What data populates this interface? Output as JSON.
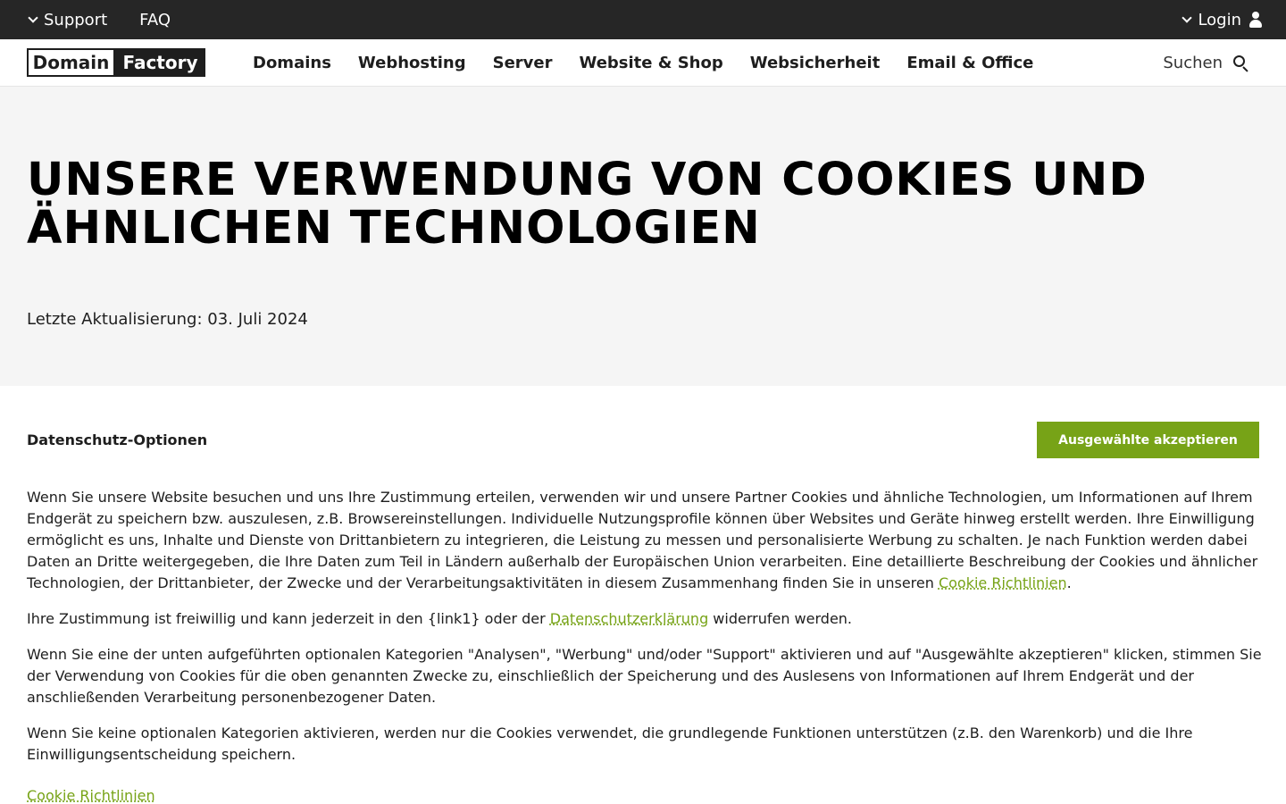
{
  "topbar": {
    "support_label": "Support",
    "faq_label": "FAQ",
    "login_label": "Login"
  },
  "nav": {
    "logo_left": "Domain",
    "logo_right": "Factory",
    "items": [
      "Domains",
      "Webhosting",
      "Server",
      "Website & Shop",
      "Websicherheit",
      "Email & Office"
    ],
    "search_label": "Suchen"
  },
  "hero": {
    "title": "UNSERE VERWENDUNG VON COOKIES UND ÄHNLICHEN TECHNOLOGIEN",
    "updated": "Letzte Aktualisierung: 03. Juli 2024"
  },
  "privacy": {
    "title": "Datenschutz-Optionen",
    "accept_label": "Ausgewählte akzeptieren",
    "p1": "Wenn Sie unsere Website besuchen und uns Ihre Zustimmung erteilen, verwenden wir und unsere Partner Cookies und ähnliche Technologien, um Informationen auf Ihrem Endgerät zu speichern bzw. auszulesen, z.B. Browsereinstellungen. Individuelle Nutzungsprofile können über Websites und Geräte hinweg erstellt werden. Ihre Einwilligung ermöglicht es uns, Inhalte und Dienste von Drittanbietern zu integrieren, die Leistung zu messen und personalisierte Werbung zu schalten. Je nach Funktion werden dabei Daten an Dritte weitergegeben, die Ihre Daten zum Teil in Ländern außerhalb der Europäischen Union verarbeiten. Eine detaillierte Beschreibung der Cookies und ähnlicher Technologien, der Drittanbieter, der Zwecke und der Verarbeitungsaktivitäten in diesem Zusammenhang finden Sie in unseren ",
    "p1_link": "Cookie Richtlinien",
    "p1_end": ".",
    "p2": "Ihre Zustimmung ist freiwillig und kann jederzeit in den {link1} oder der ",
    "p2_link": "Datenschutzerklärung",
    "p2_end": " widerrufen werden.",
    "p3": "Wenn Sie eine der unten aufgeführten optionalen Kategorien \"Analysen\", \"Werbung\" und/oder \"Support\" aktivieren und auf \"Ausgewählte akzeptieren\" klicken, stimmen Sie der Verwendung von Cookies für die oben genannten Zwecke zu, einschließlich der Speicherung und des Auslesens von Informationen auf Ihrem Endgerät und der anschließenden Verarbeitung personenbezogener Daten.",
    "p4": "Wenn Sie keine optionalen Kategorien aktivieren, werden nur die Cookies verwendet, die grundlegende Funktionen unterstützen (z.B. den Warenkorb) und die Ihre Einwilligungsentscheidung speichern.",
    "bottom_link": "Cookie Richtlinien"
  },
  "colors": {
    "accent": "#77a317",
    "topbar_bg": "#262626",
    "hero_bg": "#f5f5f5"
  }
}
